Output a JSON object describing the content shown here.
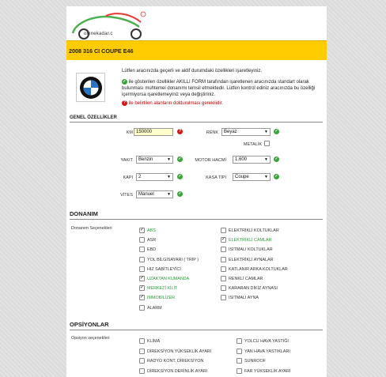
{
  "logo": {
    "text": "omnekadar.c"
  },
  "listing": {
    "title": "2008 316 CI COUPE E46"
  },
  "intro": {
    "line1": "Lütfen aracınızda geçerli ve aktif durumdaki özellikleri işaretleyiniz.",
    "line2": "ile gösterilen özellikler AKILLI FORM tarafından işaretlenen aracınızda standart olarak bulunması muhtemel donanımı temsil etmektedir. Lütfen kontrol ediniz aracınızda bu özelliği içermiyorsa işaretlemeyiniz veya değiştiriniz.",
    "line3": "ile belirtilen alanların doldurulması gerekliidir."
  },
  "general": {
    "heading": "GENEL ÖZELLİKLER",
    "km_label": "KM",
    "km_value": "150000",
    "renk_label": "RENK",
    "renk_value": "Beyaz",
    "metalik_label": "METALİK",
    "yakit_label": "YAKIT",
    "yakit_value": "Benzin",
    "motor_label": "MOTOR HACMİ",
    "motor_value": "1.600",
    "kapi_label": "KAPI",
    "kapi_value": "2",
    "kasa_label": "KASA TİPİ",
    "kasa_value": "Coupe",
    "vites_label": "VİTES",
    "vites_value": "Manuel"
  },
  "donanim": {
    "heading": "DONANIM",
    "group_label": "Donanım Seçenekleri",
    "left": [
      {
        "label": "ABS",
        "checked": true,
        "green": true
      },
      {
        "label": "ASR",
        "checked": false,
        "green": false
      },
      {
        "label": "EBD",
        "checked": false,
        "green": false
      },
      {
        "label": "YOL BİLGİSAYARI ( TRİP )",
        "checked": false,
        "green": false
      },
      {
        "label": "HIZ SABİTLEYİCİ",
        "checked": false,
        "green": false
      },
      {
        "label": "UZAKTAN KUMANDA",
        "checked": true,
        "green": true
      },
      {
        "label": "MERKEZİ KİLİT",
        "checked": true,
        "green": true
      },
      {
        "label": "İMMOBİLİZER",
        "checked": true,
        "green": true
      },
      {
        "label": "ALARM",
        "checked": false,
        "green": false
      }
    ],
    "right": [
      {
        "label": "ELEKTRİKLİ KOLTUKLAR",
        "checked": false,
        "green": false
      },
      {
        "label": "ELEKTRİKLİ CAMLAR",
        "checked": true,
        "green": true
      },
      {
        "label": "ISITMALI KOLTUKLAR",
        "checked": false,
        "green": false
      },
      {
        "label": "ELEKTRİKLİ AYNALAR",
        "checked": false,
        "green": false
      },
      {
        "label": "KATLANIR ARKA KOLTUKLAR",
        "checked": false,
        "green": false
      },
      {
        "label": "RENKLİ CAMLAR",
        "checked": false,
        "green": false
      },
      {
        "label": "KARARAN DİKİZ AYNASI",
        "checked": false,
        "green": false
      },
      {
        "label": "ISITMALI AYNA",
        "checked": false,
        "green": false
      }
    ]
  },
  "opsiyonlar": {
    "heading": "OPSİYONLAR",
    "group_label": "Opsiyon seçenekleri",
    "left": [
      {
        "label": "KLİMA",
        "checked": false
      },
      {
        "label": "DİREKSİYON YÜKSEKLİK AYARI",
        "checked": false
      },
      {
        "label": "RADYO KONT. DİREKSİYON",
        "checked": false
      },
      {
        "label": "DİREKSİYON DERİNLİK AYARI",
        "checked": false
      }
    ],
    "right": [
      {
        "label": "YOLCU HAVA YASTIĞI",
        "checked": false
      },
      {
        "label": "YAN HAVA YASTIKLARI",
        "checked": false
      },
      {
        "label": "SUNROOF",
        "checked": false
      },
      {
        "label": "FAR YÜKSEKLİK AYARI",
        "checked": false
      }
    ]
  },
  "colors": {
    "accent": "#fecc00",
    "ok": "#3aa33a",
    "error": "#d31818",
    "green_text": "#2b9a3a"
  }
}
